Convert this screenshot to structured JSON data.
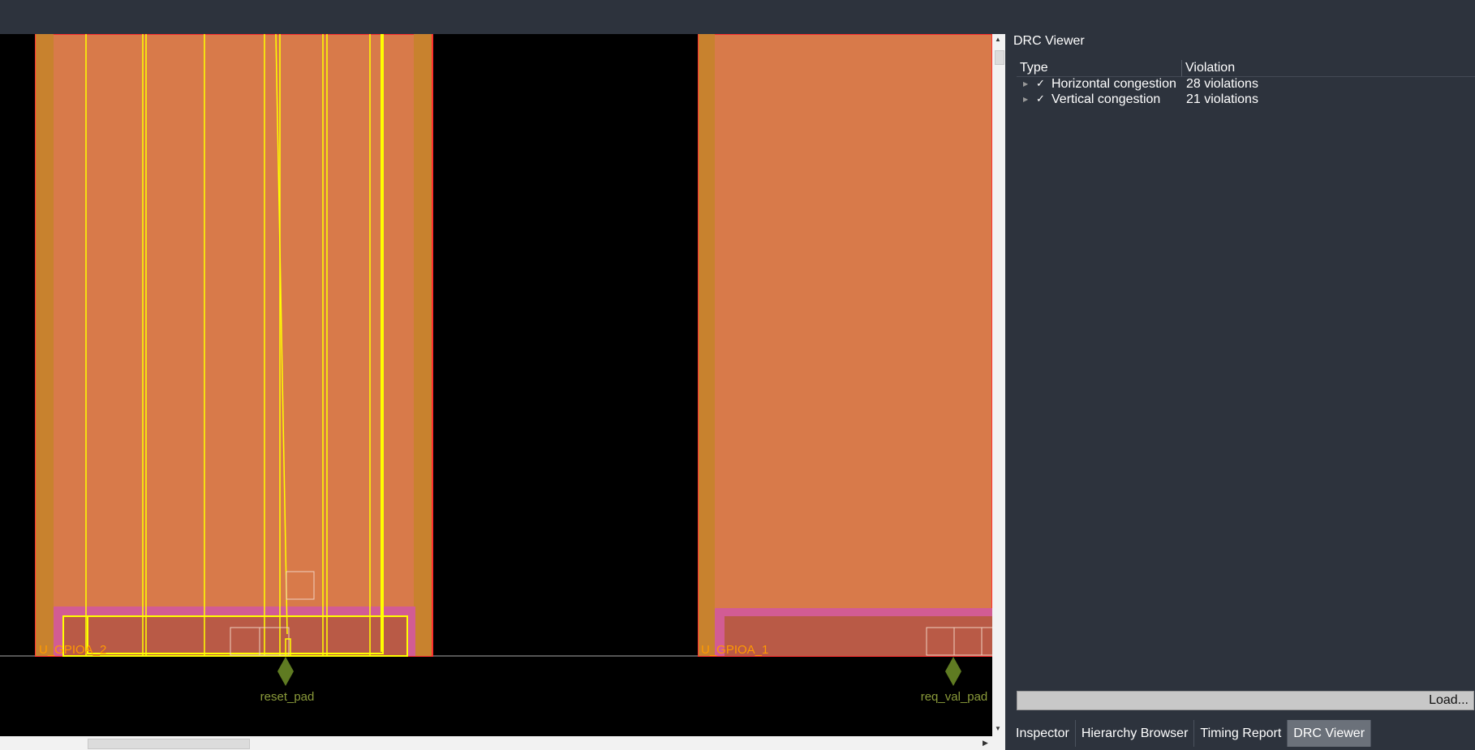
{
  "layout": {
    "instances": [
      {
        "name": "U_GPIOA_2"
      },
      {
        "name": "U_GPIOA_1"
      }
    ],
    "pins": [
      {
        "name": "reset_pad"
      },
      {
        "name": "req_val_pad"
      }
    ],
    "colors": {
      "background": "#000000",
      "macro_fill": "#d87a4a",
      "macro_border": "#ff3030",
      "halo": "#d25c94",
      "core": "#b95a46",
      "nets": "#ffff00",
      "pin_marker": "#5f7b22",
      "instance_label": "#ff9a00"
    }
  },
  "drc_viewer": {
    "title": "DRC Viewer",
    "columns": [
      "Type",
      "Violation"
    ],
    "rows": [
      {
        "check": "✓",
        "type": "Horizontal congestion",
        "violation": "28 violations"
      },
      {
        "check": "✓",
        "type": "Vertical congestion",
        "violation": "21 violations"
      }
    ],
    "load_label": "Load..."
  },
  "tabs": [
    {
      "label": "Inspector",
      "active": false
    },
    {
      "label": "Hierarchy Browser",
      "active": false
    },
    {
      "label": "Timing Report",
      "active": false
    },
    {
      "label": "DRC Viewer",
      "active": true
    }
  ]
}
